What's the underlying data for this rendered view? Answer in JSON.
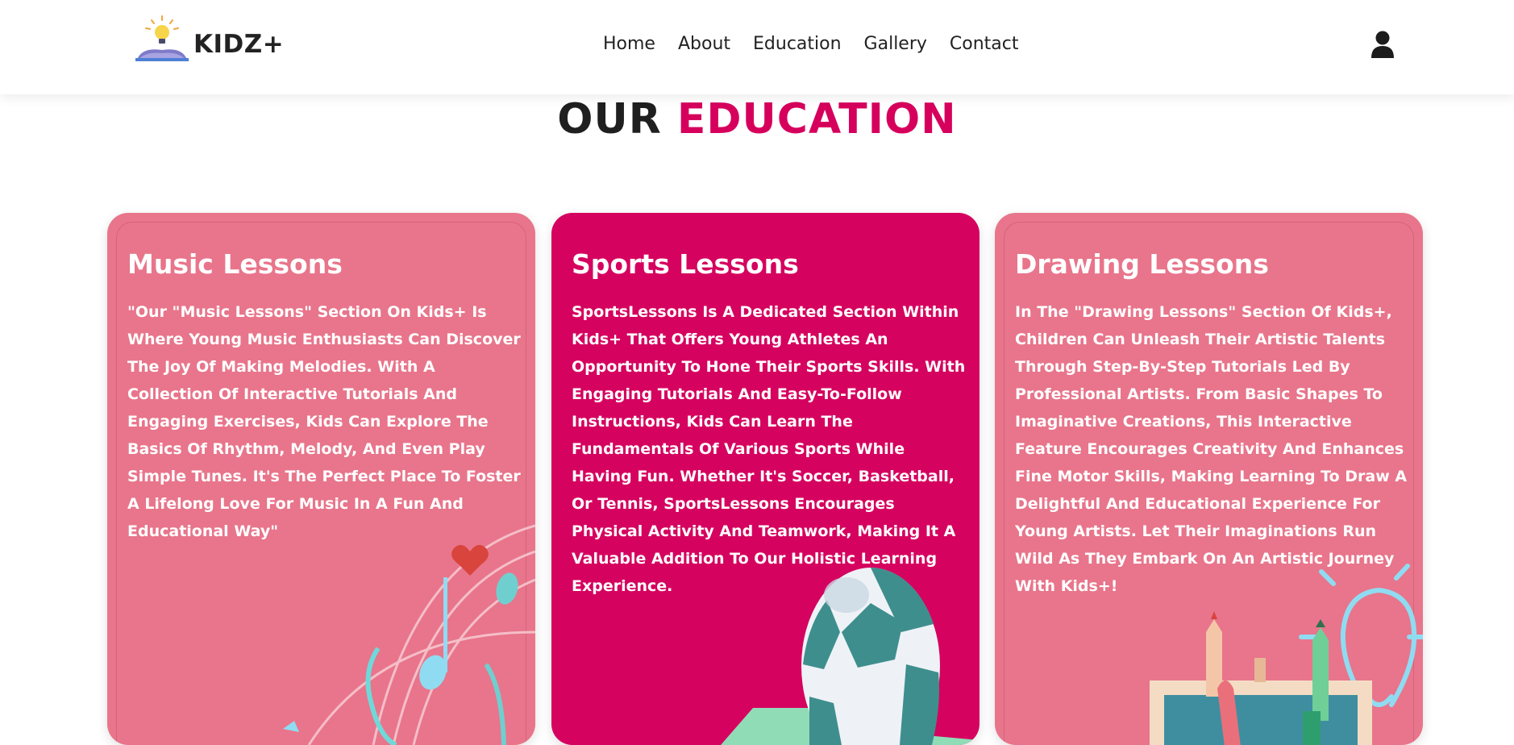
{
  "brand": {
    "name": "KIDZ+",
    "logo_icon": "lightbulb-book-icon"
  },
  "nav": {
    "items": [
      "Home",
      "About",
      "Education",
      "Gallery",
      "Contact"
    ],
    "user_icon": "user-icon"
  },
  "section": {
    "title_part1": "OUR",
    "title_part2": "EDUCATION"
  },
  "cards": [
    {
      "title": "Music Lessons",
      "text": "\"Our \"Music Lessons\" Section On Kids+ Is Where Young Music Enthusiasts Can Discover The Joy Of Making Melodies. With A Collection Of Interactive Tutorials And Engaging Exercises, Kids Can Explore The Basics Of Rhythm, Melody, And Even Play Simple Tunes. It's The Perfect Place To Foster A Lifelong Love For Music In A Fun And Educational Way\"",
      "illustration": "music-notes-illustration",
      "color": "#e8758b"
    },
    {
      "title": "Sports Lessons",
      "text": "SportsLessons Is A Dedicated Section Within Kids+ That Offers Young Athletes An Opportunity To Hone Their Sports Skills. With Engaging Tutorials And Easy-To-Follow Instructions, Kids Can Learn The Fundamentals Of Various Sports While Having Fun. Whether It's Soccer, Basketball, Or Tennis, SportsLessons Encourages Physical Activity And Teamwork, Making It A Valuable Addition To Our Holistic Learning Experience.",
      "illustration": "soccer-ball-illustration",
      "color": "#d5035f"
    },
    {
      "title": "Drawing Lessons",
      "text": "In The \"Drawing Lessons\" Section Of Kids+, Children Can Unleash Their Artistic Talents Through Step-By-Step Tutorials Led By Professional Artists. From Basic Shapes To Imaginative Creations, This Interactive Feature Encourages Creativity And Enhances Fine Motor Skills, Making Learning To Draw A Delightful And Educational Experience For Young Artists. Let Their Imaginations Run Wild As They Embark On An Artistic Journey With Kids+!",
      "illustration": "pencils-lightbulb-illustration",
      "color": "#e8758b"
    }
  ],
  "colors": {
    "accent": "#d6005c",
    "card_pink": "#e8758b",
    "card_magenta": "#d5035f"
  }
}
